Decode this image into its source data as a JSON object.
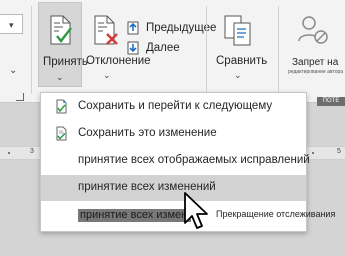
{
  "ribbon": {
    "accept_label": "Принять",
    "reject_label": "Отклонение",
    "previous_label": "Предыдущее",
    "next_label": "Далее",
    "compare_label": "Сравнить",
    "block_label": "Запрет на",
    "block_sublabel": "редактирование автора",
    "group_label": "ПОТЕ"
  },
  "ruler": {
    "left_number": "3",
    "right_number": "5"
  },
  "accept_menu": {
    "items": [
      {
        "label": "Сохранить и перейти к следующему",
        "icon": "accept-and-next-icon"
      },
      {
        "label": "Сохранить это изменение",
        "icon": "accept-change-icon"
      },
      {
        "label": "принятие всех отображаемых исправлений",
        "icon": ""
      },
      {
        "label": "принятие всех изменений",
        "icon": ""
      },
      {
        "label": "принятие всех изменен",
        "icon": ""
      }
    ],
    "submenu_label": "Прекращение отслеживания"
  },
  "colors": {
    "ribbon_bg": "#f3f3f3",
    "check_green": "#2e9a44",
    "reject_red": "#d23a3a",
    "highlight": "#d2d2d2"
  }
}
